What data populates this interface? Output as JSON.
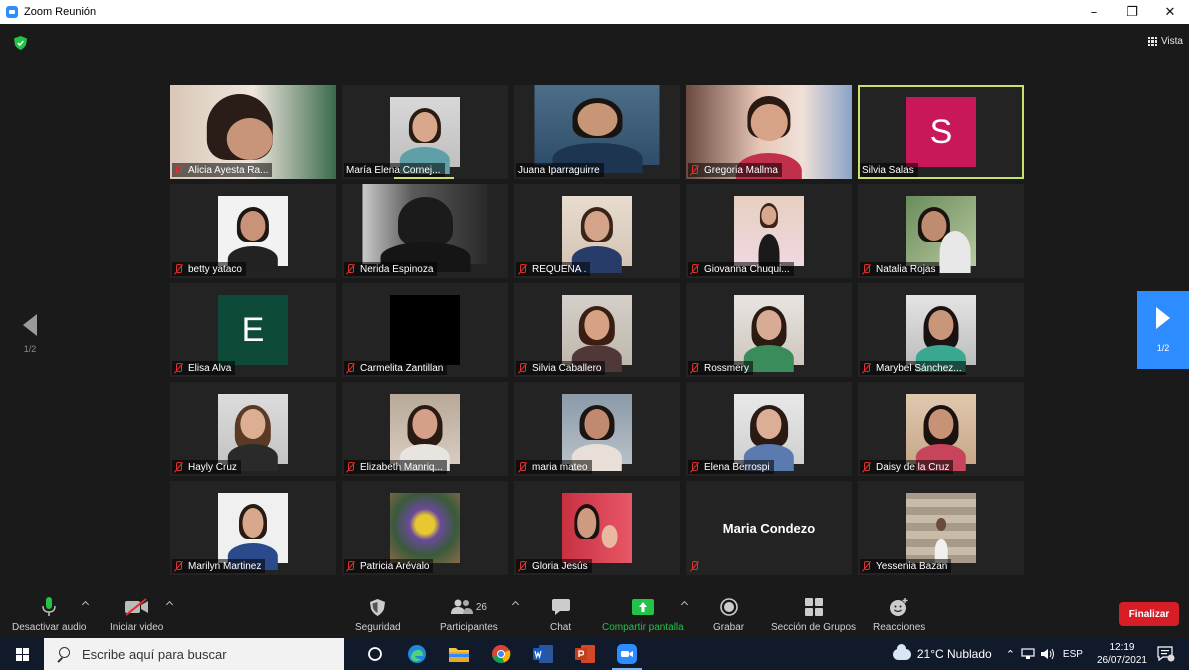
{
  "window": {
    "title": "Zoom Reunión",
    "minimize": "–",
    "restore": "❐",
    "close": "✕"
  },
  "header": {
    "view_label": "Vista"
  },
  "pager": {
    "left": "1/2",
    "right": "1/2"
  },
  "participants": [
    {
      "name": "Alicia Ayesta Ra...",
      "muted": true
    },
    {
      "name": "María Elena Cornej...",
      "muted": false
    },
    {
      "name": "Juana Iparraguirre",
      "muted": false
    },
    {
      "name": "Gregoria Mallma",
      "muted": true
    },
    {
      "name": "Silvia Salas",
      "muted": false,
      "avatar_letter": "S",
      "avatar_color": "#c8185a"
    },
    {
      "name": "betty yataco",
      "muted": true
    },
    {
      "name": "Nerida Espinoza",
      "muted": true
    },
    {
      "name": "REQUENA .",
      "muted": true
    },
    {
      "name": "Giovanna Chuqui...",
      "muted": true
    },
    {
      "name": "Natalia Rojas",
      "muted": true
    },
    {
      "name": "Elisa Alva",
      "muted": true,
      "avatar_letter": "E",
      "avatar_color": "#0e4a3a"
    },
    {
      "name": "Carmelita Zantillan",
      "muted": true
    },
    {
      "name": "Silvia Caballero",
      "muted": true
    },
    {
      "name": "Rossmery",
      "muted": true
    },
    {
      "name": "Marybel Sánchez...",
      "muted": true
    },
    {
      "name": "Hayly Cruz",
      "muted": true
    },
    {
      "name": "Elizabeth Manriq...",
      "muted": true
    },
    {
      "name": "maria mateo",
      "muted": true
    },
    {
      "name": "Elena Berrospi",
      "muted": true
    },
    {
      "name": "Daisy de la Cruz",
      "muted": true
    },
    {
      "name": "Marilyn Martinez",
      "muted": true
    },
    {
      "name": "Patricia Arévalo",
      "muted": true
    },
    {
      "name": "Gloria Jesús",
      "muted": true
    },
    {
      "name": "",
      "muted": true,
      "center_name": "Maria Condezo"
    },
    {
      "name": "Yessenia Bazan",
      "muted": true
    }
  ],
  "toolbar": {
    "mute_audio": "Desactivar audio",
    "start_video": "Iniciar video",
    "security": "Seguridad",
    "participants": "Participantes",
    "participants_count": "26",
    "chat": "Chat",
    "share_screen": "Compartir pantalla",
    "record": "Grabar",
    "breakout": "Sección de Grupos",
    "reactions": "Reacciones",
    "end": "Finalizar"
  },
  "taskbar": {
    "search_placeholder": "Escribe aquí para buscar",
    "weather": "21°C  Nublado",
    "lang": "ESP",
    "time": "12:19",
    "date": "26/07/2021"
  },
  "colors": {
    "accent": "#2d8cff",
    "active_speaker": "#c5e26c",
    "end_button": "#d71e26",
    "share_green": "#23c248"
  }
}
